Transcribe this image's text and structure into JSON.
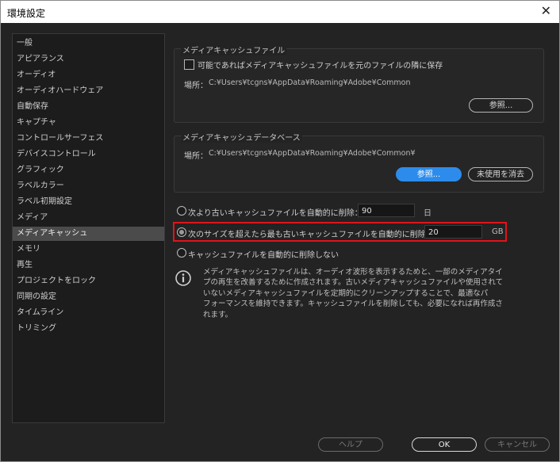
{
  "window": {
    "title": "環境設定",
    "close_glyph": "✕"
  },
  "sidebar": {
    "items": [
      {
        "label": "一般"
      },
      {
        "label": "アピアランス"
      },
      {
        "label": "オーディオ"
      },
      {
        "label": "オーディオハードウェア"
      },
      {
        "label": "自動保存"
      },
      {
        "label": "キャプチャ"
      },
      {
        "label": "コントロールサーフェス"
      },
      {
        "label": "デバイスコントロール"
      },
      {
        "label": "グラフィック"
      },
      {
        "label": "ラベルカラー"
      },
      {
        "label": "ラベル初期設定"
      },
      {
        "label": "メディア"
      },
      {
        "label": "メディアキャッシュ",
        "selected": true
      },
      {
        "label": "メモリ"
      },
      {
        "label": "再生"
      },
      {
        "label": "プロジェクトをロック"
      },
      {
        "label": "同期の設定"
      },
      {
        "label": "タイムライン"
      },
      {
        "label": "トリミング"
      }
    ]
  },
  "cache_files": {
    "title": "メディアキャッシュファイル",
    "checkbox_label": "可能であればメディアキャッシュファイルを元のファイルの隣に保存",
    "checkbox_checked": false,
    "location_label": "場所：",
    "location_path": "C:¥Users¥tcgns¥AppData¥Roaming¥Adobe¥Common",
    "browse_label": "参照..."
  },
  "cache_db": {
    "title": "メディアキャッシュデータベース",
    "location_label": "場所：",
    "location_path": "C:¥Users¥tcgns¥AppData¥Roaming¥Adobe¥Common¥",
    "browse_label": "参照...",
    "clean_label": "未使用を消去"
  },
  "options": {
    "older_than_label": "次より古いキャッシュファイルを自動的に削除：",
    "older_than_value": "90",
    "older_than_unit": "日",
    "size_exceeds_label": "次のサイズを超えたら最も古いキャッシュファイルを自動的に削除：",
    "size_exceeds_value": "20",
    "size_exceeds_unit": "GB",
    "never_delete_label": "キャッシュファイルを自動的に削除しない",
    "selected": "size_exceeds"
  },
  "info": {
    "icon": "info-icon",
    "line1": "メディアキャッシュファイルは、オーディオ波形を表示するためと、一部のメディアタイ",
    "line2": "プの再生を改善するために作成されます。古いメディアキャッシュファイルや使用されて",
    "line3": "いないメディアキャッシュファイルを定期的にクリーンアップすることで、最適なパ",
    "line4": "フォーマンスを維持できます。キャッシュファイルを削除しても、必要になれば再作成さ",
    "line5": "れます。"
  },
  "footer": {
    "help_label": "ヘルプ",
    "ok_label": "OK",
    "cancel_label": "キャンセル"
  },
  "colors": {
    "accent": "#2d8ceb",
    "highlight": "#e0141a",
    "selected_item": "#4b4b4b"
  }
}
